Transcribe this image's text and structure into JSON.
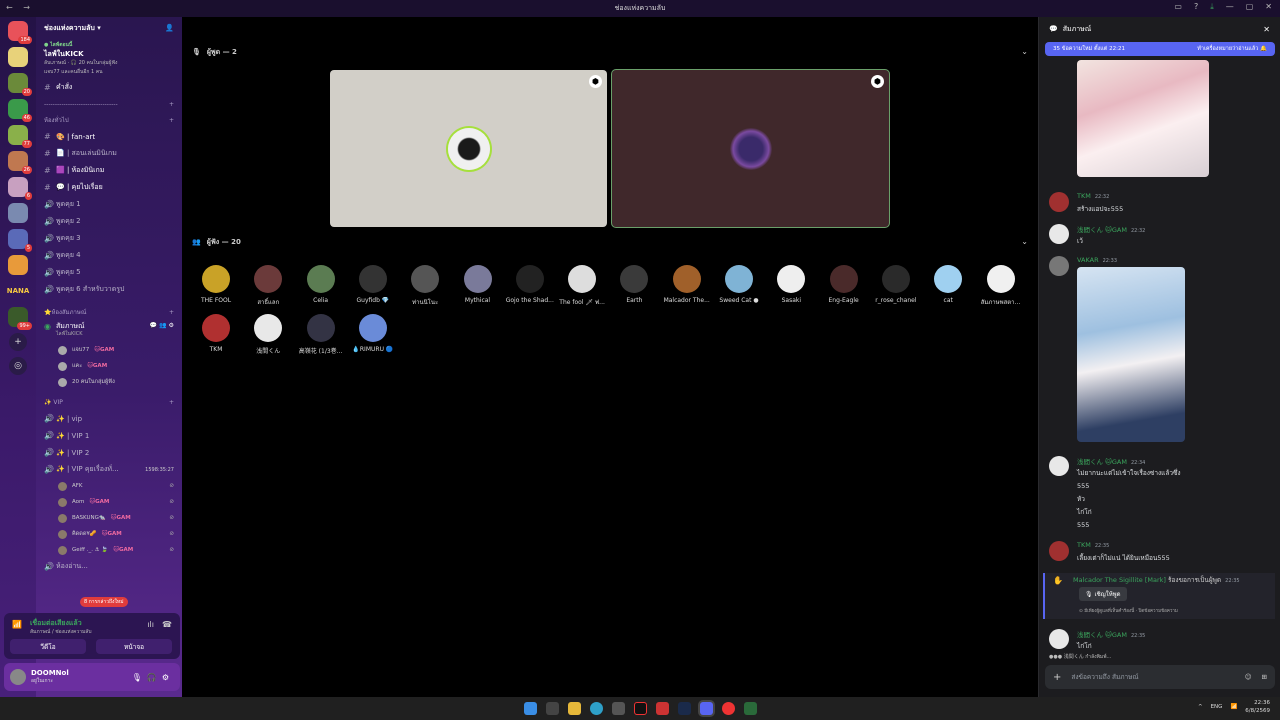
{
  "window": {
    "title": "ช่องแห่งความลับ",
    "nav": "← →"
  },
  "guild_badges": [
    "184",
    "20",
    "46",
    "77",
    "26",
    "6",
    "5",
    "99+"
  ],
  "guild_text": "NANA",
  "server": {
    "name": "ช่องแห่งความลับ ▾"
  },
  "event": {
    "live": "● ไลฟ์ตอนนี้",
    "title": "ไลฟ์ในKICK",
    "sub": "ลับเภาษณ์ · 🎧 20 คนในกลุ่มผู้ฟัง",
    "more": "แจบ77 และคนอื่นอีก 1 คน"
  },
  "channels_top": [
    {
      "name": "คำสั่ง"
    }
  ],
  "divider": "----------------------------------",
  "cat1": "ห้องทั่วไป",
  "text_channels": [
    {
      "name": "🎨 | fan-art",
      "bold": true
    },
    {
      "name": "📄 | สอนเล่นมินิเกม",
      "bold": false
    },
    {
      "name": "🟪 | ห้องมินิเกม",
      "bold": true
    },
    {
      "name": "💬 | คุยไปเรื่อย",
      "bold": true
    }
  ],
  "voice_channels": [
    {
      "name": "พูดคุย 1"
    },
    {
      "name": "พูดคุย 2"
    },
    {
      "name": "พูดคุย 3"
    },
    {
      "name": "พูดคุย 4"
    },
    {
      "name": "พูดคุย 5"
    },
    {
      "name": "พูดคุย 6 สำหรับวาดรูป"
    }
  ],
  "cat2": "⭐ห้องสัมภาษณ์",
  "stage": {
    "name": "สัมภาษณ์",
    "sub": "ไลฟ์ในKICK"
  },
  "stage_users": [
    {
      "name": "แจบ77",
      "tag": "🐱GAM"
    },
    {
      "name": "แคะ",
      "tag": "🐱GAM"
    },
    {
      "name": "20 คนในกลุ่มผู้ฟัง",
      "tag": ""
    }
  ],
  "cat3": "✨ VIP",
  "vip_channels": [
    {
      "name": "✨ | vip"
    },
    {
      "name": "✨ | VIP 1"
    },
    {
      "name": "✨ | VIP 2"
    },
    {
      "name": "✨ | VIP คุยเรื่องทั่..."
    }
  ],
  "vip_timer": "1598:35:27",
  "vip_users": [
    {
      "name": "AFK",
      "tag": ""
    },
    {
      "name": "Aom",
      "tag": "🐱GAM"
    },
    {
      "name": "BASKUNG🐀",
      "tag": "🐱GAM"
    },
    {
      "name": "คิดดด¥🥜",
      "tag": "🐱GAM"
    },
    {
      "name": "Geiff ._. ⚓ 🍃",
      "tag": "🐱GAM"
    }
  ],
  "next_channel": "ห้องอ่าน...",
  "new_mentions": "8 การกล่าวถึงใหม่",
  "voice": {
    "status": "เชื่อมต่อเสียงแล้ว",
    "where": "สัมภาษณ์ / ช่องแห่งความลับ",
    "video": "วีดีโอ",
    "screen": "หน้าจอ"
  },
  "user": {
    "name": "DOOMNol",
    "status": "อยู่ในเกาะ"
  },
  "speakers": {
    "title": "ผู้พูด — 2"
  },
  "listeners_section": {
    "title": "ผู้ฟัง — 20"
  },
  "listeners": [
    {
      "name": "THE FOOL",
      "color": "#c9a227"
    },
    {
      "name": "สาธิ์แลก",
      "color": "#6b3a3a"
    },
    {
      "name": "Celia",
      "color": "#5b7c52"
    },
    {
      "name": "Guyfidb 💎",
      "color": "#333333"
    },
    {
      "name": "ท่านนิโนะ",
      "color": "#555555"
    },
    {
      "name": "Mythical",
      "color": "#7a7a9a"
    },
    {
      "name": "Gojo the Shad...",
      "color": "#222222"
    },
    {
      "name": "The fool 🗡 ฟ...",
      "color": "#dddddd"
    },
    {
      "name": "Earth",
      "color": "#3a3a3a"
    },
    {
      "name": "Malcador The...",
      "color": "#a0602a"
    },
    {
      "name": "Sweed Cat ●",
      "color": "#7fb3d5"
    },
    {
      "name": "Sasaki",
      "color": "#eeeeee"
    },
    {
      "name": "Eng-Eagle",
      "color": "#4a2a2a"
    },
    {
      "name": "r_rose_chanel",
      "color": "#2a2a2a"
    },
    {
      "name": "cat",
      "color": "#9fd0f0"
    },
    {
      "name": "สัมภาษพสตา...",
      "color": "#f0f0f0"
    },
    {
      "name": "TKM",
      "color": "#b03030"
    },
    {
      "name": "浅間くん",
      "color": "#e8e8e8"
    },
    {
      "name": "高嶺花 (1/3巻...",
      "color": "#334"
    },
    {
      "name": "💧RIMURU 🔵",
      "color": "#6a8bd8"
    }
  ],
  "chat": {
    "title": "สัมภาษณ์",
    "banner": "35 ข้อความใหม่ ตั้งแต่ 22:21",
    "banner_action": "ทำเครื่องหมายว่าอ่านแล้ว 🔔",
    "messages": [
      {
        "author": "TKM",
        "time": "22:32",
        "text": "สร้างแอปจะ555"
      },
      {
        "author": "浅間くん 🐱GAM",
        "time": "22:32",
        "text": "เว้"
      },
      {
        "author": "VAKAR",
        "time": "22:33",
        "text": ""
      },
      {
        "author": "浅間くん 🐱GAM",
        "time": "22:34",
        "lines": [
          "ไม่ยากนะแต่ไม่เข้าใจเรื่องซ่างแล้วซึ่ง",
          "555",
          "หัว",
          "ไก่โก่",
          "555"
        ]
      },
      {
        "author": "TKM",
        "time": "22:35",
        "text": "เลี้ยงเต่าก็ไม่แน่ ได้ยินเหมือน555"
      },
      {
        "author": "Malcador The Sigillite [Mark]",
        "time": "22:35",
        "text": "ร้องขอการเป็นผู้พูด",
        "button": "🎙 เชิญให้พูด",
        "note": "⊙ มีเพียงผู้ดูแลที่เห็นคำร้องนี้ · ปิดข้อความข้อความ"
      },
      {
        "author": "浅間くん 🐱GAM",
        "time": "22:35",
        "text": "ไก่โก่"
      }
    ],
    "typing": "浅間くん กำลังพิมพ์...",
    "composer_placeholder": "ส่งข้อความถึง สัมภาษณ์"
  },
  "tray": {
    "lang": "ENG",
    "time": "22:36",
    "date": "6/8/2569"
  }
}
